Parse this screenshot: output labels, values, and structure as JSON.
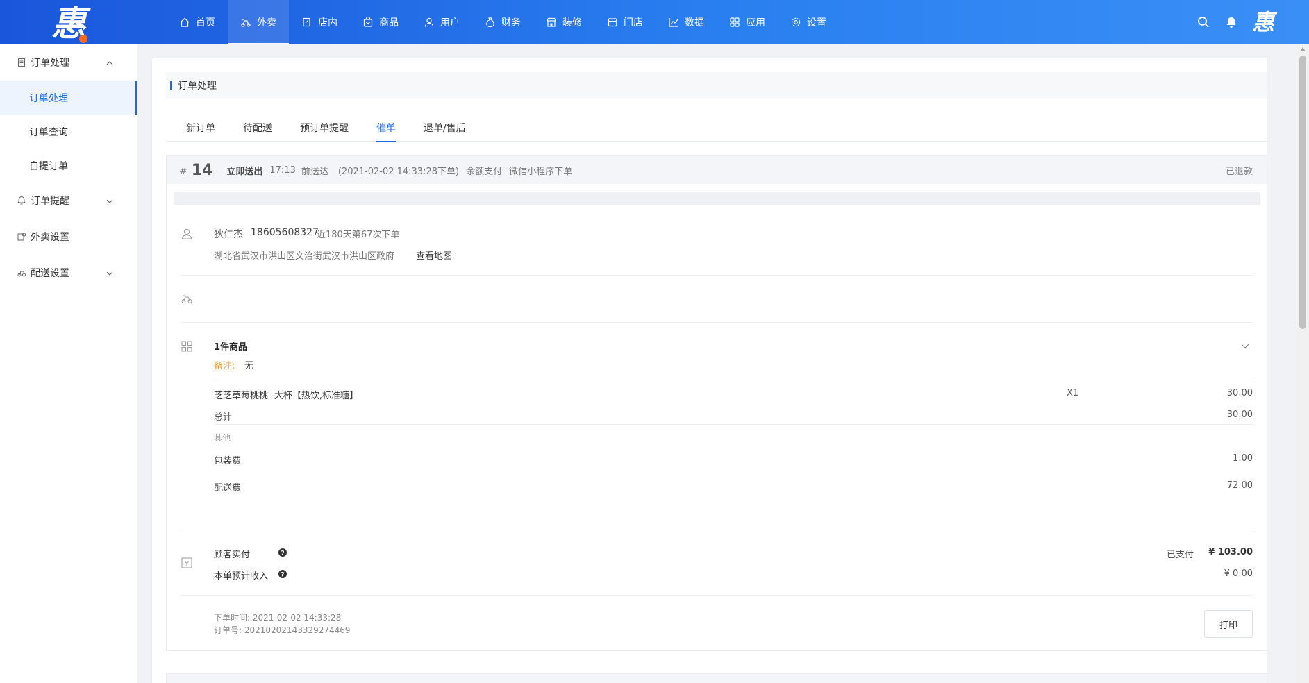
{
  "brand": {
    "logo_char": "惠",
    "avatar_char": "惠"
  },
  "nav": [
    {
      "label": "首页",
      "icon": "home-icon"
    },
    {
      "label": "外卖",
      "icon": "scooter-icon",
      "active": true
    },
    {
      "label": "店内",
      "icon": "edit-icon"
    },
    {
      "label": "商品",
      "icon": "bag-icon"
    },
    {
      "label": "用户",
      "icon": "user-icon"
    },
    {
      "label": "财务",
      "icon": "money-bag-icon"
    },
    {
      "label": "装修",
      "icon": "shop-icon"
    },
    {
      "label": "门店",
      "icon": "store-icon"
    },
    {
      "label": "数据",
      "icon": "chart-icon"
    },
    {
      "label": "应用",
      "icon": "apps-icon"
    },
    {
      "label": "设置",
      "icon": "gear-icon"
    }
  ],
  "sidebar": {
    "group1": {
      "label": "订单处理"
    },
    "subs": [
      "订单处理",
      "订单查询",
      "自提订单"
    ],
    "group2": {
      "label": "订单提醒"
    },
    "group3": {
      "label": "外卖设置"
    },
    "group4": {
      "label": "配送设置"
    }
  },
  "page": {
    "title": "订单处理"
  },
  "tabs": [
    "新订单",
    "待配送",
    "预订单提醒",
    "催单",
    "退单/售后"
  ],
  "order": {
    "hash": "#",
    "number": "14",
    "delivery_type": "立即送出",
    "time": "17:13",
    "arrive": "前送达",
    "placed": "(2021-02-02 14:33:28下单)",
    "payment": "余额支付",
    "source": "微信小程序下单",
    "status": "已退款",
    "customer_name": "狄仁杰",
    "customer_phone": "18605608327",
    "customer_history": "近180天第67次下单",
    "address": "湖北省武汉市洪山区文治街武汉市洪山区政府",
    "map_link": "查看地图",
    "items_count": "1件商品",
    "remark_label": "备注:",
    "remark_value": "无",
    "item_name": "芝芝草莓桃桃 -大杯【热饮,标准糖】",
    "item_qty": "X1",
    "item_price": "30.00",
    "total_label": "总计",
    "total_value": "30.00",
    "other_label": "其他",
    "pack_label": "包装费",
    "pack_value": "1.00",
    "ship_label": "配送费",
    "ship_value": "72.00",
    "paid_label": "顾客实付",
    "paid_status": "已支付",
    "paid_value": "¥ 103.00",
    "income_label": "本单预计收入",
    "income_value": "¥ 0.00",
    "order_time": "下单时间: 2021-02-02 14:33:28",
    "order_no": "订单号: 20210202143329274469",
    "print_label": "打印"
  },
  "colors": {
    "primary": "#1a6ae8",
    "nav_gradient_start": "#1a56db",
    "remark": "#e6a23c",
    "logo_dot": "#ff6a1a"
  }
}
